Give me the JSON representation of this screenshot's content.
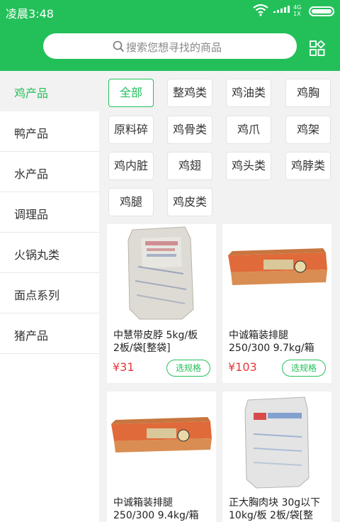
{
  "status_bar": {
    "time": "凌晨3:48",
    "network_top": "4G",
    "network_bottom": "1X"
  },
  "search": {
    "placeholder": "搜索您想寻找的商品"
  },
  "colors": {
    "brand": "#23c05a",
    "price": "#e4393c"
  },
  "icons": {
    "search": "search-icon",
    "categories": "grid-icon"
  },
  "sidebar": {
    "items": [
      {
        "label": "鸡产品",
        "active": true
      },
      {
        "label": "鸭产品"
      },
      {
        "label": "水产品"
      },
      {
        "label": "调理品"
      },
      {
        "label": "火锅丸类"
      },
      {
        "label": "面点系列"
      },
      {
        "label": "猪产品"
      }
    ]
  },
  "tags": [
    "全部",
    "整鸡类",
    "鸡油类",
    "鸡胸",
    "原料碎",
    "鸡骨类",
    "鸡爪",
    "鸡架",
    "鸡内脏",
    "鸡翅",
    "鸡头类",
    "鸡脖类",
    "鸡腿",
    "鸡皮类"
  ],
  "products": [
    {
      "name_line1": "中慧带皮脖 5kg/板",
      "name_line2": "2板/袋[整袋]",
      "price": "¥31",
      "spec_label": "选规格"
    },
    {
      "name_line1": "中诚箱装排腿",
      "name_line2": "250/300 9.7kg/箱",
      "price": "¥103",
      "spec_label": "选规格"
    },
    {
      "name_line1": "中诚箱装排腿",
      "name_line2": "250/300 9.4kg/箱"
    },
    {
      "name_line1": "正大胸肉块 30g以下",
      "name_line2": "10kg/板 2板/袋[整"
    }
  ]
}
